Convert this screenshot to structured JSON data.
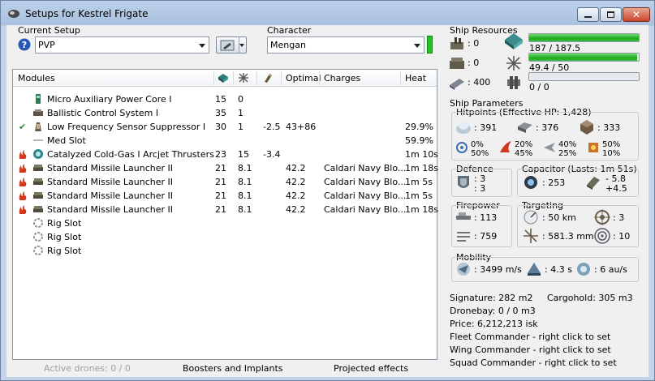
{
  "window": {
    "title": "Setups for Kestrel Frigate"
  },
  "setup": {
    "label": "Current Setup",
    "value": "PVP"
  },
  "character": {
    "label": "Character",
    "value": "Mengan"
  },
  "modules": {
    "headers": {
      "module": "Modules",
      "optimal": "Optimal",
      "charges": "Charges",
      "heat": "Heat"
    },
    "rows": [
      {
        "name": "Micro Auxiliary Power Core I",
        "cpu": "15",
        "pg": "0",
        "cap": "",
        "optimal": "",
        "charges": "",
        "heat": "",
        "icon": "power-core-icon",
        "check": false
      },
      {
        "name": "Ballistic Control System I",
        "cpu": "35",
        "pg": "1",
        "cap": "",
        "optimal": "",
        "charges": "",
        "heat": "",
        "icon": "ballistic-control-icon",
        "check": false
      },
      {
        "name": "Low Frequency Sensor Suppressor I",
        "cpu": "30",
        "pg": "1",
        "cap": "-2.5",
        "optimal": "43+86",
        "charges": "",
        "heat": "29.9%",
        "icon": "sensor-suppressor-icon",
        "check": true
      },
      {
        "name": "Med Slot",
        "cpu": "",
        "pg": "",
        "cap": "",
        "optimal": "",
        "charges": "",
        "heat": "59.9%",
        "icon": "empty-med-slot-icon",
        "check": false
      },
      {
        "name": "Catalyzed Cold-Gas I Arcjet Thrusters",
        "cpu": "23",
        "pg": "15",
        "cap": "-3.4",
        "optimal": "",
        "charges": "",
        "heat": "1m 10s",
        "icon": "thrusters-icon",
        "check": false
      },
      {
        "name": "Standard Missile Launcher II",
        "cpu": "21",
        "pg": "8.1",
        "cap": "",
        "optimal": "42.2",
        "charges": "Caldari Navy Blo...",
        "heat": "1m 18s",
        "icon": "missile-launcher-icon",
        "check": false
      },
      {
        "name": "Standard Missile Launcher II",
        "cpu": "21",
        "pg": "8.1",
        "cap": "",
        "optimal": "42.2",
        "charges": "Caldari Navy Blo...",
        "heat": "1m 5s",
        "icon": "missile-launcher-icon",
        "check": false
      },
      {
        "name": "Standard Missile Launcher II",
        "cpu": "21",
        "pg": "8.1",
        "cap": "",
        "optimal": "42.2",
        "charges": "Caldari Navy Blo...",
        "heat": "1m 5s",
        "icon": "missile-launcher-icon",
        "check": false
      },
      {
        "name": "Standard Missile Launcher II",
        "cpu": "21",
        "pg": "8.1",
        "cap": "",
        "optimal": "42.2",
        "charges": "Caldari Navy Blo...",
        "heat": "1m 18s",
        "icon": "missile-launcher-icon",
        "check": false
      },
      {
        "name": "Rig Slot",
        "cpu": "",
        "pg": "",
        "cap": "",
        "optimal": "",
        "charges": "",
        "heat": "",
        "icon": "rig-slot-icon",
        "check": false
      },
      {
        "name": "Rig Slot",
        "cpu": "",
        "pg": "",
        "cap": "",
        "optimal": "",
        "charges": "",
        "heat": "",
        "icon": "rig-slot-icon",
        "check": false
      },
      {
        "name": "Rig Slot",
        "cpu": "",
        "pg": "",
        "cap": "",
        "optimal": "",
        "charges": "",
        "heat": "",
        "icon": "rig-slot-icon",
        "check": false
      }
    ]
  },
  "bottom": {
    "drones": "Active drones: 0 / 0",
    "boosters": "Boosters and Implants",
    "projected": "Projected effects"
  },
  "resources": {
    "title": "Ship Resources",
    "turrets": ": 0",
    "launchers": ": 0",
    "calibration": ": 400",
    "cpu": {
      "text": "187 / 187.5",
      "fraction": 0.997
    },
    "powergrid": {
      "text": "49.4 / 50",
      "fraction": 0.988
    },
    "drone_bandwidth": {
      "text": "0 / 0",
      "fraction": 0
    }
  },
  "params": {
    "title": "Ship Parameters",
    "hitpoints_title": "Hitpoints (Effective HP: 1,428)",
    "shield": ": 391",
    "armor": ": 376",
    "hull": ": 333",
    "resists": [
      {
        "a": "0%",
        "b": "50%"
      },
      {
        "a": "20%",
        "b": "45%"
      },
      {
        "a": "40%",
        "b": "25%"
      },
      {
        "a": "50%",
        "b": "10%"
      }
    ],
    "defence_title": "Defence",
    "defence_a": ": 3",
    "defence_b": ": 3",
    "capacitor_title": "Capacitor (Lasts: 1m 51s)",
    "capacitor_amount": ": 253",
    "cap_a": "- 5.8",
    "cap_b": "+4.5",
    "firepower_title": "Firepower",
    "dps": ": 113",
    "volley": ": 759",
    "targeting_title": "Targeting",
    "range": ": 50 km",
    "max_targets": ": 3",
    "resolution": ": 581.3 mm",
    "scan_res": ": 10",
    "mobility_title": "Mobility",
    "speed": ": 3499 m/s",
    "align": ": 4.3 s",
    "warp": ": 6 au/s"
  },
  "info": {
    "signature": "Signature: 282 m2",
    "cargohold": "Cargohold: 305 m3",
    "dronebay": "Dronebay: 0 / 0 m3",
    "price": "Price: 6,212,213 isk",
    "fleet": "Fleet Commander - right click to set",
    "wing": "Wing Commander - right click to set",
    "squad": "Squad Commander - right click to set"
  }
}
